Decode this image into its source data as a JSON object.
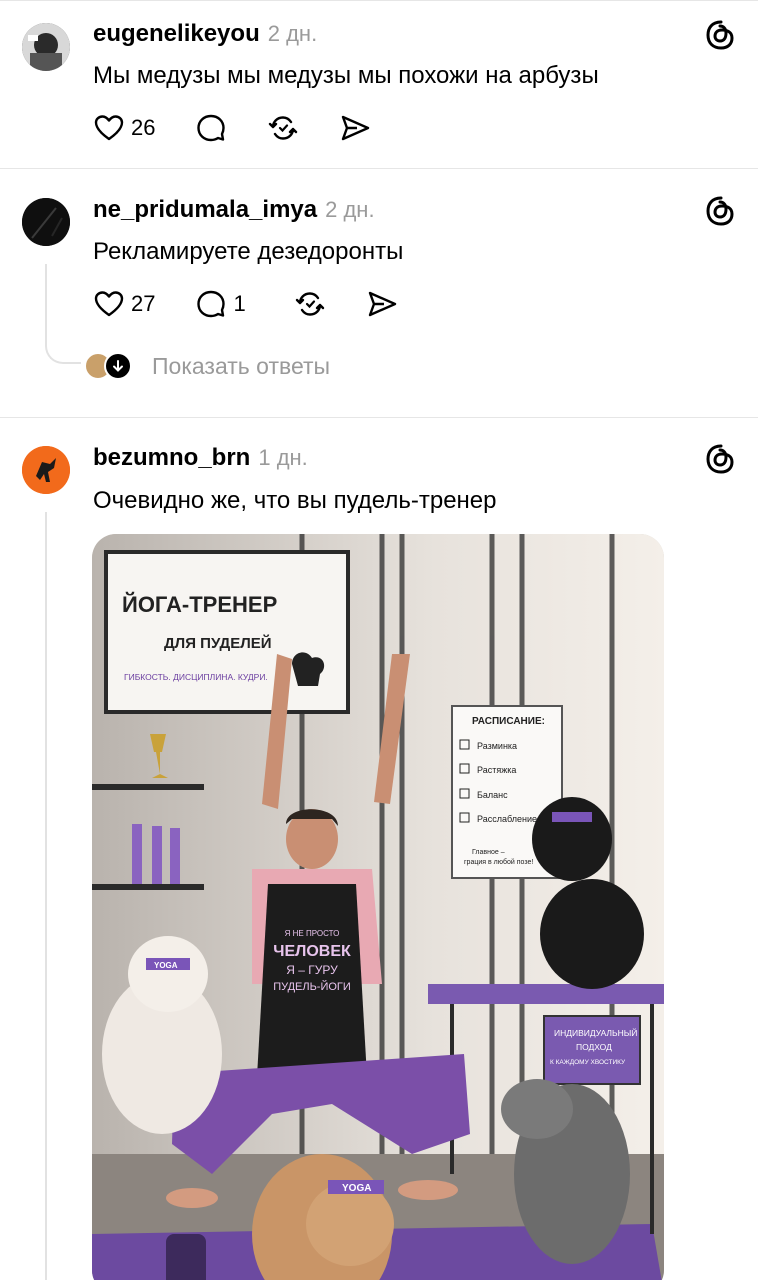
{
  "posts": [
    {
      "username": "eugenelikeyou",
      "time": "2 дн.",
      "text": "Мы медузы мы медузы мы похожи на арбузы",
      "likes": "26",
      "replies": ""
    },
    {
      "username": "ne_pridumala_imya",
      "time": "2 дн.",
      "text": "Рекламируете дезедоронты",
      "likes": "27",
      "replies": "1",
      "show_replies": "Показать ответы"
    },
    {
      "username": "bezumno_brn",
      "time": "1 дн.",
      "text": "Очевидно же, что вы пудель-тренер"
    }
  ],
  "image": {
    "sign_title": "ЙОГА-ТРЕНЕР",
    "sign_sub": "ДЛЯ ПУДЕЛЕЙ",
    "sign_tag": "ГИБКОСТЬ. ДИСЦИПЛИНА. КУДРИ.",
    "schedule_title": "РАСПИСАНИЕ:",
    "schedule_items": [
      "Разминка",
      "Растяжка",
      "Баланс",
      "Расслабление"
    ],
    "schedule_note1": "Главное –",
    "schedule_note2": "грация в любой позе!",
    "apron1": "Я НЕ ПРОСТО",
    "apron2": "ЧЕЛОВЕК",
    "apron3": "Я – ГУРУ",
    "apron4": "ПУДЕЛЬ-ЙОГИ",
    "card1": "ИНДИВИДУАЛЬНЫЙ",
    "card2": "ПОДХОД",
    "card3": "К КАЖДОМУ ХВОСТИКУ",
    "headband": "YOGA"
  },
  "icons": {
    "like": "heart-icon",
    "comment": "comment-icon",
    "repost": "repost-icon",
    "share": "send-icon",
    "threads": "threads-logo-icon"
  }
}
